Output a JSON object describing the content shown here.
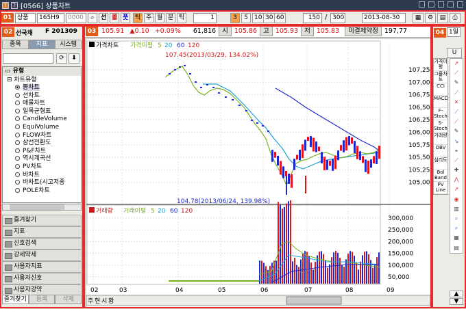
{
  "window": {
    "title": "[0566] 상품차트",
    "icon_text": "?"
  },
  "toolbar": {
    "badge": "01",
    "market": "상품",
    "code": "165H9",
    "code2": "0000",
    "buttons": [
      "선",
      "콜",
      "풋"
    ],
    "period_buttons": [
      "틱",
      "주",
      "월",
      "분",
      "틱"
    ],
    "periods": [
      "1",
      "3",
      "5",
      "10",
      "30",
      "60"
    ],
    "count": "150",
    "total": "300",
    "date": "2013-08-30"
  },
  "left": {
    "badge": "02",
    "name": "선국채",
    "code": "F 201309",
    "tabs": [
      "종목",
      "지표",
      "시스템"
    ],
    "root": "유형",
    "group": "차트유형",
    "types": [
      "봉차트",
      "선차트",
      "매물차트",
      "일목균형표",
      "CandleVolume",
      "EquiVolume",
      "FLOW차트",
      "삼선전환도",
      "P&F차트",
      "역시계곡선",
      "PV차트",
      "바차트",
      "바차트(시고저종",
      "POLE차트"
    ],
    "accordion": [
      "즐겨찾기",
      "지표",
      "신호검색",
      "강세약세",
      "사용자지표",
      "사용자신호",
      "사용자강약"
    ],
    "bottom_tabs": [
      "즐겨찾기",
      "등록",
      "삭제"
    ]
  },
  "quote": {
    "badge": "03",
    "price": "105.91",
    "change": "▲0.10",
    "pct": "+0.09%",
    "volume": "61,816",
    "open_label": "시",
    "open": "105.86",
    "high_label": "고",
    "high": "105.93",
    "low_label": "저",
    "low": "105.83",
    "oi_label": "미결제약정",
    "oi": "197,77"
  },
  "price_chart": {
    "legend_main": "가격차트",
    "legend_ma": "가격이평",
    "ma_periods": [
      "5",
      "20",
      "60",
      "120"
    ],
    "high_annot": "107.45(2013/03/29, 134.02%)",
    "low_annot": "104.78(2013/06/24, 139.98%)",
    "ylabels": [
      "107,25",
      "107,00",
      "106,75",
      "106,50",
      "106,25",
      "106,00",
      "105,75",
      "105,50",
      "105,25",
      "105,00"
    ]
  },
  "volume_chart": {
    "legend_main": "거래량",
    "legend_ma": "거래이평",
    "ma_periods": [
      "5",
      "20",
      "60",
      "120"
    ],
    "ylabels": [
      "300,000",
      "250,000",
      "200,000",
      "150,000",
      "100,000",
      "50,000"
    ]
  },
  "xaxis": {
    "labels": [
      "02",
      "03",
      "04",
      "05",
      "06",
      "07",
      "08",
      "09"
    ]
  },
  "bottom_bar": {
    "labels": [
      "주",
      "현",
      "시",
      "황"
    ]
  },
  "right": {
    "badge": "04",
    "period": "1일",
    "indicators": [
      "가격이평",
      "그물차트",
      "CCI",
      "MACD",
      "F-Stoch",
      "S-Stoch",
      "거래량",
      "OBV",
      "심리도",
      "Bol Band",
      "PV Line"
    ]
  },
  "colors": {
    "ma5": "#7ab020",
    "ma20": "#1da0d8",
    "ma60": "#1b2ac8",
    "ma120": "#c81a1a",
    "up": "#e0141a",
    "down": "#1b2ac8"
  }
}
